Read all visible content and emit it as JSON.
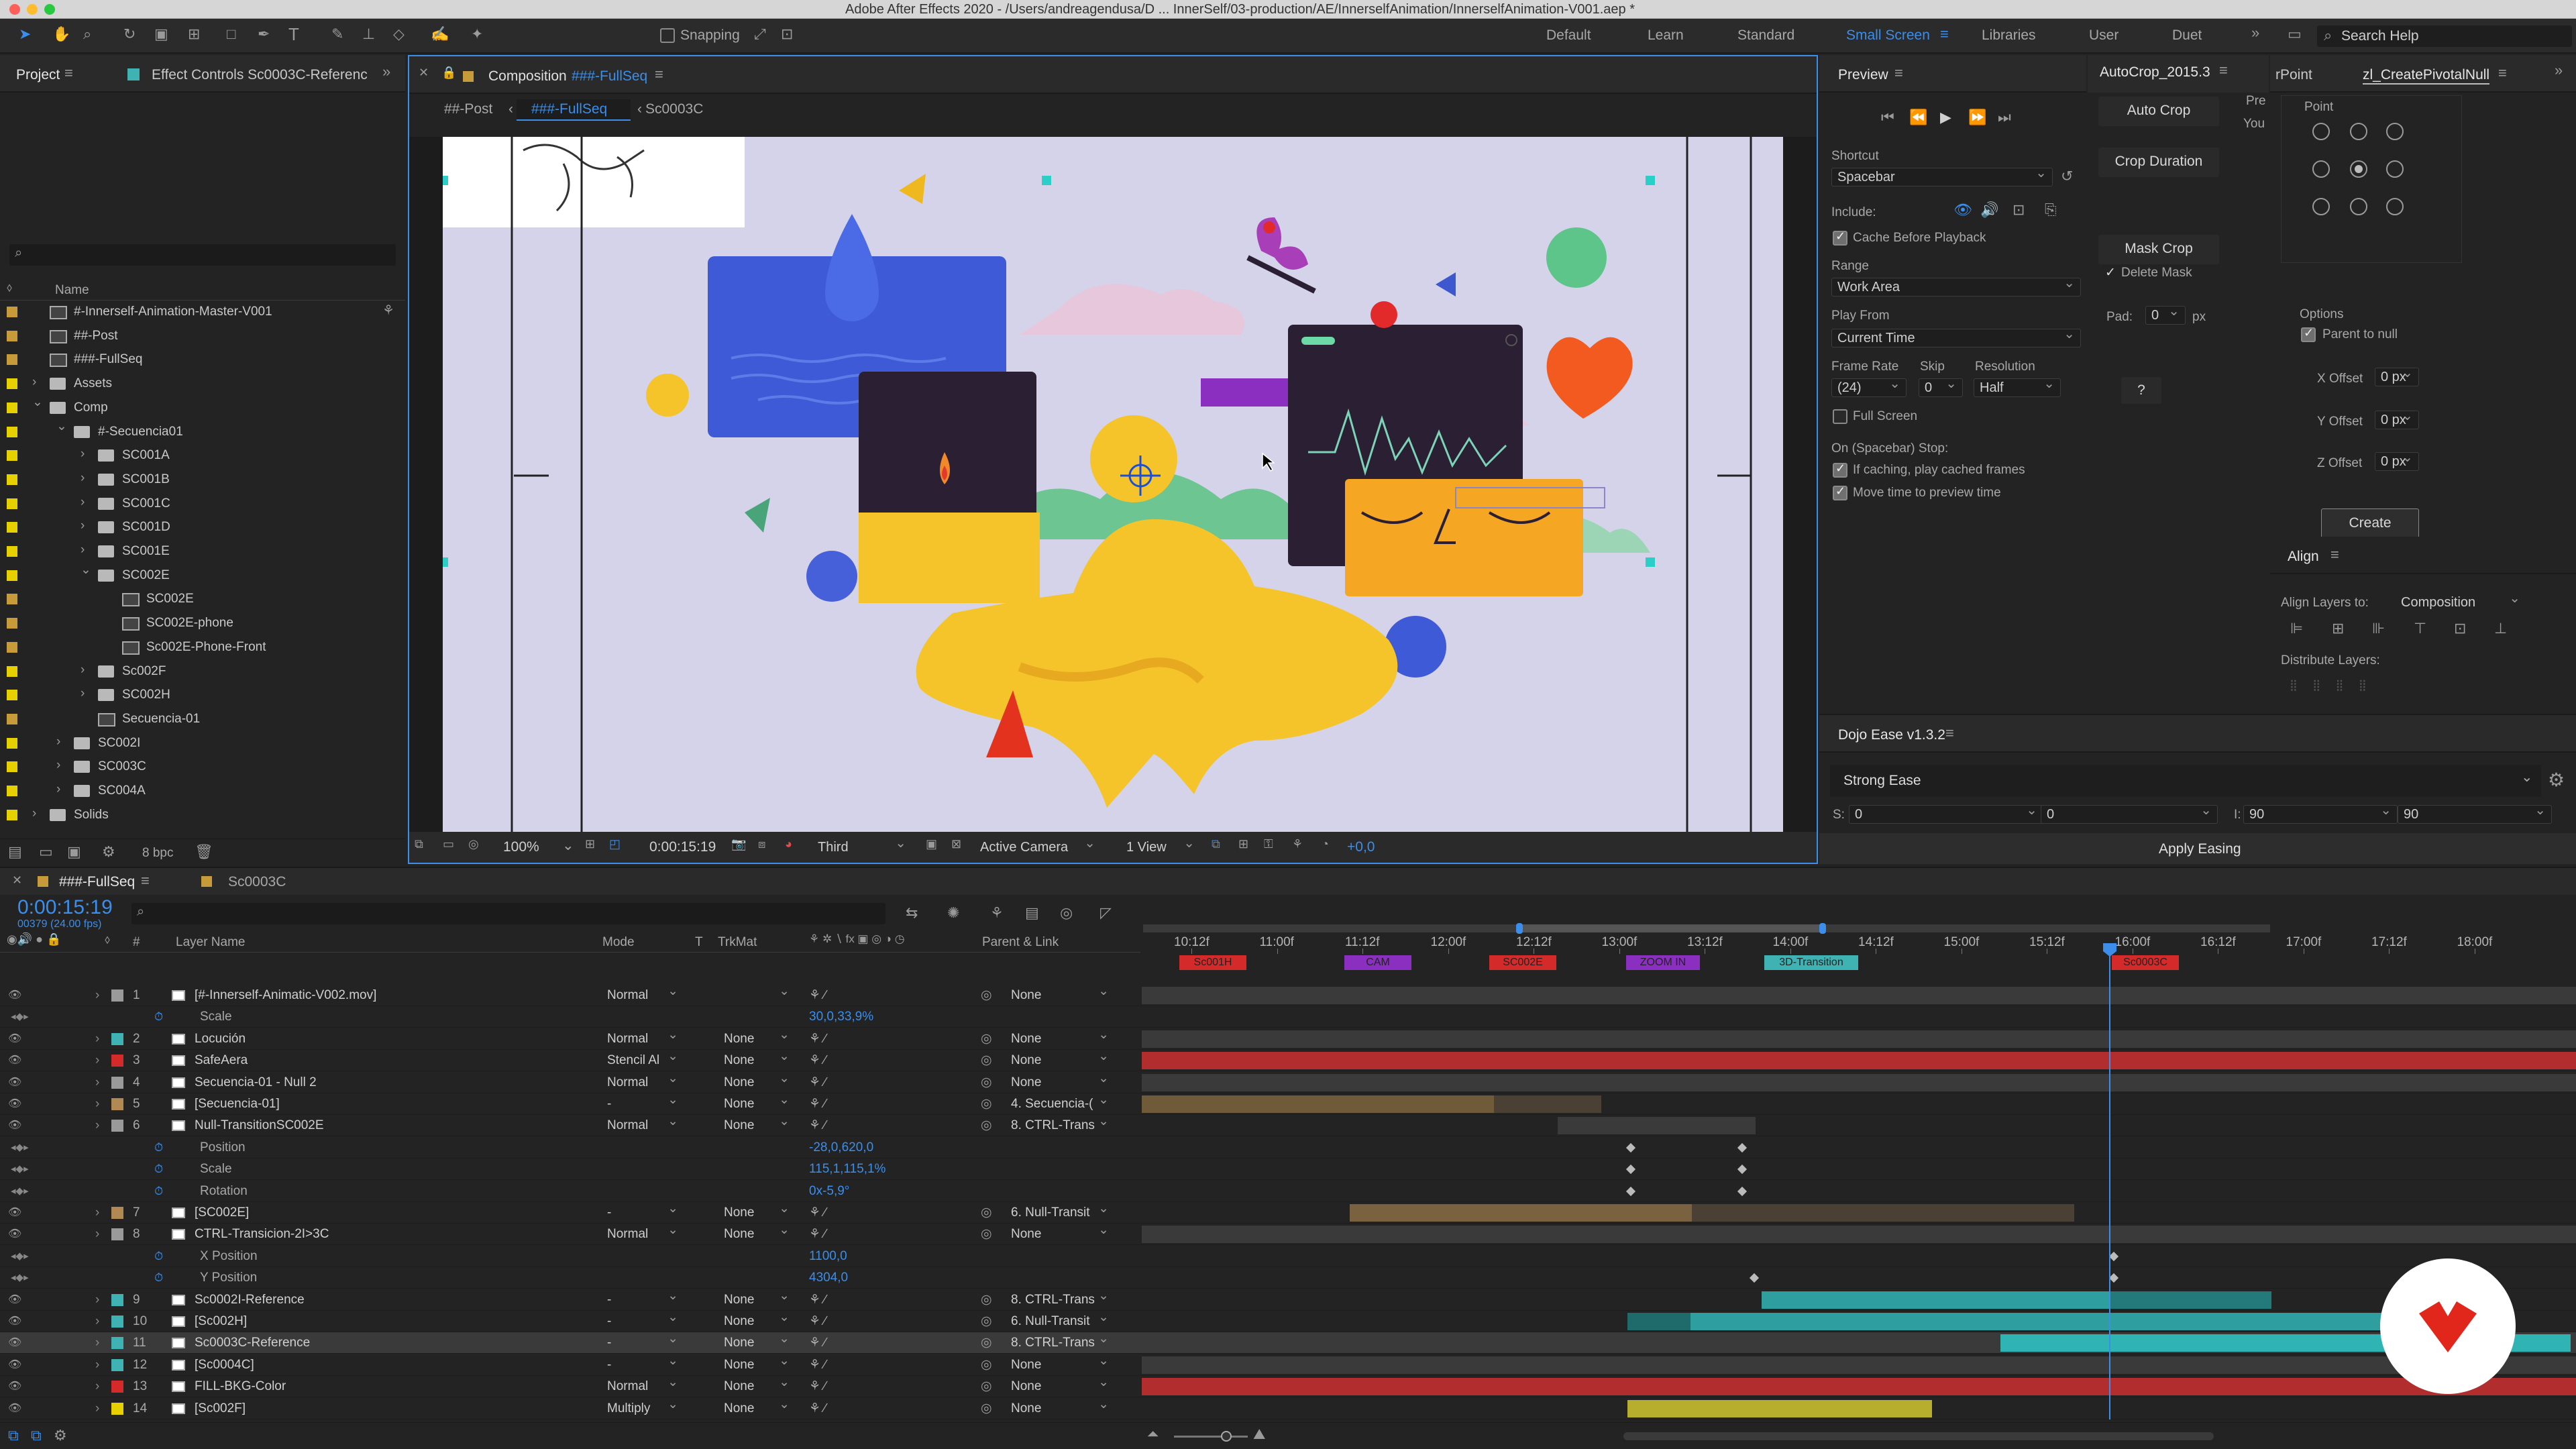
{
  "app": {
    "title": "Adobe After Effects 2020 - /Users/andreagendusa/D ... InnerSelf/03-production/AE/InnerselfAnimation/InnerselfAnimation-V001.aep *"
  },
  "toolbar": {
    "snapping_label": "Snapping",
    "workspaces": [
      "Default",
      "Learn",
      "Standard",
      "Small Screen",
      "Libraries",
      "User",
      "Duet"
    ],
    "active_workspace": "Small Screen",
    "search_placeholder": "Search Help"
  },
  "project_panel": {
    "tab_project": "Project",
    "tab_effect_controls": "Effect Controls Sc0003C-Referenc",
    "column_name": "Name",
    "bpc": "8 bpc",
    "items": [
      {
        "name": "#-Innerself-Animation-Master-V001",
        "kind": "comp",
        "color": "#c79a3a"
      },
      {
        "name": "##-Post",
        "kind": "comp",
        "color": "#c79a3a"
      },
      {
        "name": "###-FullSeq",
        "kind": "comp",
        "color": "#c79a3a"
      },
      {
        "name": "Assets",
        "kind": "folder",
        "color": "#e6d000"
      },
      {
        "name": "Comp",
        "kind": "folder",
        "color": "#e6d000"
      },
      {
        "name": "#-Secuencia01",
        "kind": "folder",
        "color": "#e6d000"
      },
      {
        "name": "SC001A",
        "kind": "folder",
        "color": "#e6d000"
      },
      {
        "name": "SC001B",
        "kind": "folder",
        "color": "#e6d000"
      },
      {
        "name": "SC001C",
        "kind": "folder",
        "color": "#e6d000"
      },
      {
        "name": "SC001D",
        "kind": "folder",
        "color": "#e6d000"
      },
      {
        "name": "SC001E",
        "kind": "folder",
        "color": "#e6d000"
      },
      {
        "name": "SC002E",
        "kind": "folder",
        "color": "#e6d000"
      },
      {
        "name": "SC002E",
        "kind": "comp",
        "color": "#c79a3a"
      },
      {
        "name": "SC002E-phone",
        "kind": "comp",
        "color": "#c79a3a"
      },
      {
        "name": "Sc002E-Phone-Front",
        "kind": "comp",
        "color": "#c79a3a"
      },
      {
        "name": "Sc002F",
        "kind": "folder",
        "color": "#e6d000"
      },
      {
        "name": "SC002H",
        "kind": "folder",
        "color": "#e6d000"
      },
      {
        "name": "Secuencia-01",
        "kind": "comp",
        "color": "#c79a3a"
      },
      {
        "name": "SC002I",
        "kind": "folder",
        "color": "#e6d000"
      },
      {
        "name": "SC003C",
        "kind": "folder",
        "color": "#e6d000"
      },
      {
        "name": "SC004A",
        "kind": "folder",
        "color": "#e6d000"
      },
      {
        "name": "Solids",
        "kind": "folder",
        "color": "#e6d000"
      }
    ]
  },
  "composition_panel": {
    "tab_title_prefix": "Composition",
    "tab_title_name": "###-FullSeq",
    "breadcrumbs": [
      "##-Post",
      "###-FullSeq",
      "Sc0003C"
    ],
    "zoom": "100%",
    "timecode": "0:00:15:19",
    "resolution": "Third",
    "camera": "Active Camera",
    "views": "1 View",
    "exposure": "+0,0"
  },
  "preview_panel": {
    "title": "Preview",
    "shortcut_label": "Shortcut",
    "shortcut_value": "Spacebar",
    "include_label": "Include:",
    "cache_before_playback": "Cache Before Playback",
    "range_label": "Range",
    "range_value": "Work Area",
    "play_from_label": "Play From",
    "play_from_value": "Current Time",
    "frame_rate_label": "Frame Rate",
    "frame_rate_value": "(24)",
    "skip_label": "Skip",
    "skip_value": "0",
    "resolution_label": "Resolution",
    "resolution_value": "Half",
    "full_screen": "Full Screen",
    "on_stop_label": "On (Spacebar) Stop:",
    "if_caching": "If caching, play cached frames",
    "move_time": "Move time to preview time"
  },
  "autocrop_panel": {
    "title": "AutoCrop_2015.3",
    "auto_crop": "Auto Crop",
    "crop_duration": "Crop Duration",
    "mask_crop": "Mask Crop",
    "delete_mask": "Delete Mask",
    "pad_label": "Pad:",
    "pad_value": "0",
    "pad_unit": "px",
    "help": "?",
    "side_a": "Pre",
    "side_b": "You"
  },
  "pivotal_panel": {
    "tab_left": "rPoint",
    "tab_active": "zl_CreatePivotalNull",
    "point_label": "Point",
    "options_label": "Options",
    "parent_to_null": "Parent to null",
    "x_offset_label": "X Offset",
    "x_offset_value": "0 px",
    "y_offset_label": "Y Offset",
    "y_offset_value": "0 px",
    "z_offset_label": "Z Offset",
    "z_offset_value": "0 px",
    "create": "Create"
  },
  "align_panel": {
    "title": "Align",
    "align_layers_to": "Align Layers to:",
    "align_target": "Composition",
    "distribute_layers": "Distribute Layers:"
  },
  "dojo_panel": {
    "title": "Dojo Ease v1.3.2",
    "preset": "Strong Ease",
    "s_label": "S:",
    "s_value1": "0",
    "s_value2": "0",
    "i_label": "I:",
    "i_value1": "90",
    "i_value2": "90",
    "apply": "Apply Easing"
  },
  "timeline": {
    "tab_active": "###-FullSeq",
    "tab_other": "Sc0003C",
    "timecode": "0:00:15:19",
    "frame_info": "00379 (24.00 fps)",
    "col_layer_name": "Layer Name",
    "col_mode": "Mode",
    "col_t": "T",
    "col_trkmat": "TrkMat",
    "col_parent": "Parent & Link",
    "ruler": [
      "10:12f",
      "11:00f",
      "11:12f",
      "12:00f",
      "12:12f",
      "13:00f",
      "13:12f",
      "14:00f",
      "14:12f",
      "15:00f",
      "15:12f",
      "16:00f",
      "16:12f",
      "17:00f",
      "17:12f",
      "18:00f"
    ],
    "markers": [
      "Sc001H",
      "CAM",
      "SC002E",
      "ZOOM IN",
      "3D-Transition",
      "Sc0003C"
    ],
    "rows": [
      {
        "num": "1",
        "name": "[#-Innerself-Animatic-V002.mov]",
        "mode": "Normal",
        "trkmat": "",
        "parent": "None",
        "label": "#9a9a9a",
        "kind": "layer"
      },
      {
        "num": "",
        "name": "Scale",
        "value": "30,0,33,9%",
        "kind": "prop"
      },
      {
        "num": "2",
        "name": "Locución",
        "mode": "Normal",
        "trkmat": "None",
        "parent": "None",
        "label": "#3fb3b3",
        "kind": "layer"
      },
      {
        "num": "3",
        "name": "SafeAera",
        "mode": "Stencil Al",
        "trkmat": "None",
        "parent": "None",
        "label": "#d42a2a",
        "kind": "layer"
      },
      {
        "num": "4",
        "name": "Secuencia-01 - Null 2",
        "mode": "Normal",
        "trkmat": "None",
        "parent": "None",
        "label": "#9a9a9a",
        "kind": "layer"
      },
      {
        "num": "5",
        "name": "[Secuencia-01]",
        "mode": "-",
        "trkmat": "None",
        "parent": "4. Secuencia-(",
        "label": "#b08a52",
        "kind": "layer"
      },
      {
        "num": "6",
        "name": "Null-TransitionSC002E",
        "mode": "Normal",
        "trkmat": "None",
        "parent": "8. CTRL-Trans",
        "label": "#9a9a9a",
        "kind": "layer"
      },
      {
        "num": "",
        "name": "Position",
        "value": "-28,0,620,0",
        "kind": "prop"
      },
      {
        "num": "",
        "name": "Scale",
        "value": "115,1,115,1%",
        "kind": "prop"
      },
      {
        "num": "",
        "name": "Rotation",
        "value": "0x-5,9°",
        "kind": "prop"
      },
      {
        "num": "7",
        "name": "[SC002E]",
        "mode": "-",
        "trkmat": "None",
        "parent": "6. Null-Transit",
        "label": "#b08a52",
        "kind": "layer"
      },
      {
        "num": "8",
        "name": "CTRL-Transicion-2I>3C",
        "mode": "Normal",
        "trkmat": "None",
        "parent": "None",
        "label": "#9a9a9a",
        "kind": "layer"
      },
      {
        "num": "",
        "name": "X Position",
        "value": "1100,0",
        "kind": "prop"
      },
      {
        "num": "",
        "name": "Y Position",
        "value": "4304,0",
        "kind": "prop"
      },
      {
        "num": "9",
        "name": "Sc0002I-Reference",
        "mode": "-",
        "trkmat": "None",
        "parent": "8. CTRL-Trans",
        "label": "#3fb3b3",
        "kind": "layer"
      },
      {
        "num": "10",
        "name": "[Sc002H]",
        "mode": "-",
        "trkmat": "None",
        "parent": "6. Null-Transit",
        "label": "#3fb3b3",
        "kind": "layer"
      },
      {
        "num": "11",
        "name": "Sc0003C-Reference",
        "mode": "-",
        "trkmat": "None",
        "parent": "8. CTRL-Trans",
        "label": "#3fb3b3",
        "kind": "layer",
        "selected": true
      },
      {
        "num": "12",
        "name": "[Sc0004C]",
        "mode": "-",
        "trkmat": "None",
        "parent": "None",
        "label": "#3fb3b3",
        "kind": "layer"
      },
      {
        "num": "13",
        "name": "FILL-BKG-Color",
        "mode": "Normal",
        "trkmat": "None",
        "parent": "None",
        "label": "#d42a2a",
        "kind": "layer"
      },
      {
        "num": "14",
        "name": "[Sc002F]",
        "mode": "Multiply",
        "trkmat": "None",
        "parent": "None",
        "label": "#e6d000",
        "kind": "layer"
      }
    ]
  }
}
